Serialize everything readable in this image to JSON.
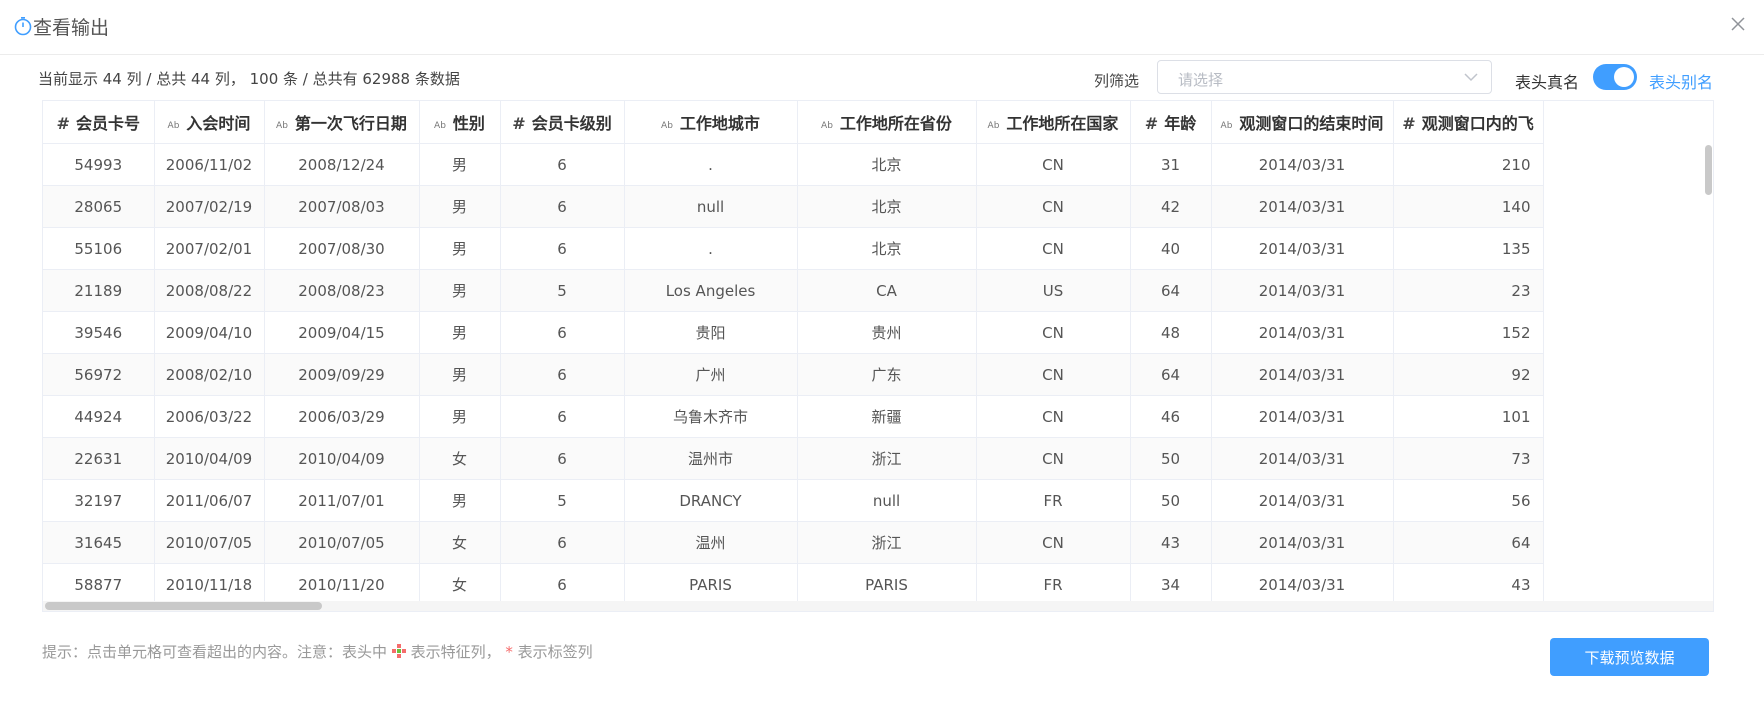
{
  "dialog": {
    "title": "查看输出",
    "summary": "当前显示 44 列 / 总共 44 列， 100 条 / 总共有 62988 条数据"
  },
  "filter": {
    "label": "列筛选",
    "placeholder": "请选择"
  },
  "header_toggle": {
    "real_name_label": "表头真名",
    "alias_label": "表头别名",
    "is_on": true
  },
  "table": {
    "columns": [
      {
        "type": "#",
        "label": "会员卡号"
      },
      {
        "type": "Ab",
        "label": "入会时间"
      },
      {
        "type": "Ab",
        "label": "第一次飞行日期"
      },
      {
        "type": "Ab",
        "label": "性别"
      },
      {
        "type": "#",
        "label": "会员卡级别"
      },
      {
        "type": "Ab",
        "label": "工作地城市"
      },
      {
        "type": "Ab",
        "label": "工作地所在省份"
      },
      {
        "type": "Ab",
        "label": "工作地所在国家"
      },
      {
        "type": "#",
        "label": "年龄"
      },
      {
        "type": "Ab",
        "label": "观测窗口的结束时间"
      },
      {
        "type": "#",
        "label": "观测窗口内的飞"
      }
    ],
    "rows": [
      [
        "54993",
        "2006/11/02",
        "2008/12/24",
        "男",
        "6",
        ".",
        "北京",
        "CN",
        "31",
        "2014/03/31",
        "210"
      ],
      [
        "28065",
        "2007/02/19",
        "2007/08/03",
        "男",
        "6",
        "null",
        "北京",
        "CN",
        "42",
        "2014/03/31",
        "140"
      ],
      [
        "55106",
        "2007/02/01",
        "2007/08/30",
        "男",
        "6",
        ".",
        "北京",
        "CN",
        "40",
        "2014/03/31",
        "135"
      ],
      [
        "21189",
        "2008/08/22",
        "2008/08/23",
        "男",
        "5",
        "Los Angeles",
        "CA",
        "US",
        "64",
        "2014/03/31",
        "23"
      ],
      [
        "39546",
        "2009/04/10",
        "2009/04/15",
        "男",
        "6",
        "贵阳",
        "贵州",
        "CN",
        "48",
        "2014/03/31",
        "152"
      ],
      [
        "56972",
        "2008/02/10",
        "2009/09/29",
        "男",
        "6",
        "广州",
        "广东",
        "CN",
        "64",
        "2014/03/31",
        "92"
      ],
      [
        "44924",
        "2006/03/22",
        "2006/03/29",
        "男",
        "6",
        "乌鲁木齐市",
        "新疆",
        "CN",
        "46",
        "2014/03/31",
        "101"
      ],
      [
        "22631",
        "2010/04/09",
        "2010/04/09",
        "女",
        "6",
        "温州市",
        "浙江",
        "CN",
        "50",
        "2014/03/31",
        "73"
      ],
      [
        "32197",
        "2011/06/07",
        "2011/07/01",
        "男",
        "5",
        "DRANCY",
        "null",
        "FR",
        "50",
        "2014/03/31",
        "56"
      ],
      [
        "31645",
        "2010/07/05",
        "2010/07/05",
        "女",
        "6",
        "温州",
        "浙江",
        "CN",
        "43",
        "2014/03/31",
        "64"
      ],
      [
        "58877",
        "2010/11/18",
        "2010/11/20",
        "女",
        "6",
        "PARIS",
        "PARIS",
        "FR",
        "34",
        "2014/03/31",
        "43"
      ]
    ]
  },
  "footer": {
    "hint_prefix": "提示：点击单元格可查看超出的内容。注意：表头中",
    "hint_middle": "表示特征列，",
    "hint_star": "*",
    "hint_suffix": "表示标签列",
    "download_label": "下载预览数据"
  },
  "colors": {
    "accent": "#409eff",
    "star": "#f56c6c"
  },
  "icons": {
    "title": "timer-icon",
    "close": "close-icon",
    "caret": "chevron-down-icon",
    "feature": "feature-column-icon"
  }
}
